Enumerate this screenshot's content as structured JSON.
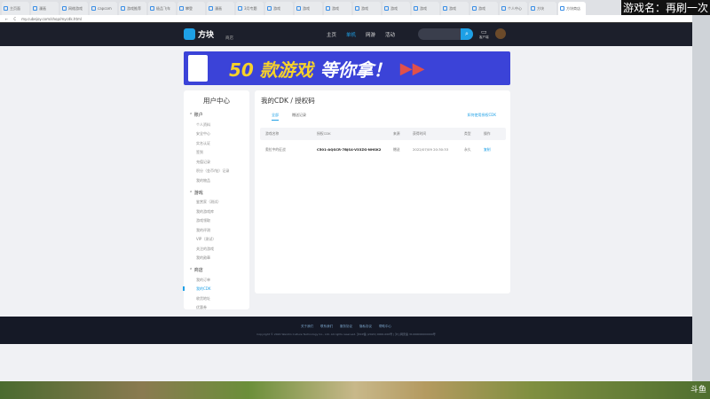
{
  "browser": {
    "tabs": [
      "主页面",
      "漫画",
      "网络游戏",
      "capcom",
      "游戏推荐",
      "极品飞车",
      "攀登",
      "漫画",
      "3月专题",
      "游戏",
      "游戏",
      "游戏",
      "游戏",
      "游戏",
      "游戏",
      "游戏",
      "游戏",
      "个人中心",
      "方块",
      "方块商店"
    ],
    "url": "my.cubejoy.com/shop/mycdk.html"
  },
  "overlay": "游戏名：再刷一次",
  "header": {
    "logo": "方块",
    "shop": "商店",
    "nav": [
      "主页",
      "单机",
      "网游",
      "活动"
    ],
    "active_nav": "单机",
    "client": "客户端"
  },
  "banner": {
    "text1": "50 款游戏",
    "text2": "等你拿！"
  },
  "sidebar": {
    "title": "用户中心",
    "groups": [
      {
        "title": "账户",
        "items": [
          "个人资料",
          "安全中心",
          "实名认证",
          "签到",
          "充值记录",
          "积分（金币/钻）记录",
          "我的物品"
        ]
      },
      {
        "title": "游戏",
        "items": [
          "鉴赏家（测试）",
          "我的游戏库",
          "游戏领取",
          "我的评测",
          "VIP（测试）",
          "关注的游戏",
          "我的勋章"
        ]
      },
      {
        "title": "商店",
        "items": [
          "我的订单",
          "我的CDK",
          "收货地址",
          "优惠券"
        ]
      }
    ],
    "active": "我的CDK"
  },
  "main": {
    "title": "我的CDK / 授权码",
    "tabs": [
      "全部",
      "赠送记录"
    ],
    "howto": "如何使用授权CDK",
    "columns": [
      "游戏名称",
      "授权CDK",
      "来源",
      "获得时间",
      "类型",
      "操作"
    ],
    "rows": [
      {
        "game": "奥拉中的征战",
        "cdk": "C501-AQSCR-7BJS4-V33ZG-NHSK2",
        "source": "赠送",
        "time": "2022/07/09 20:30:33",
        "type": "永久",
        "action": "复制"
      }
    ]
  },
  "footer": {
    "links": [
      "关于我们",
      "联系我们",
      "服务协议",
      "隐私协议",
      "帮助中心"
    ],
    "copyright": "Copyright © 2022 WanXin Culture Technology Co., Ltd. All rights reserved. 沪ICP备 (2020) 0000-000号 | 沪公网安备 31000000000000号"
  },
  "watermark": "斗鱼"
}
